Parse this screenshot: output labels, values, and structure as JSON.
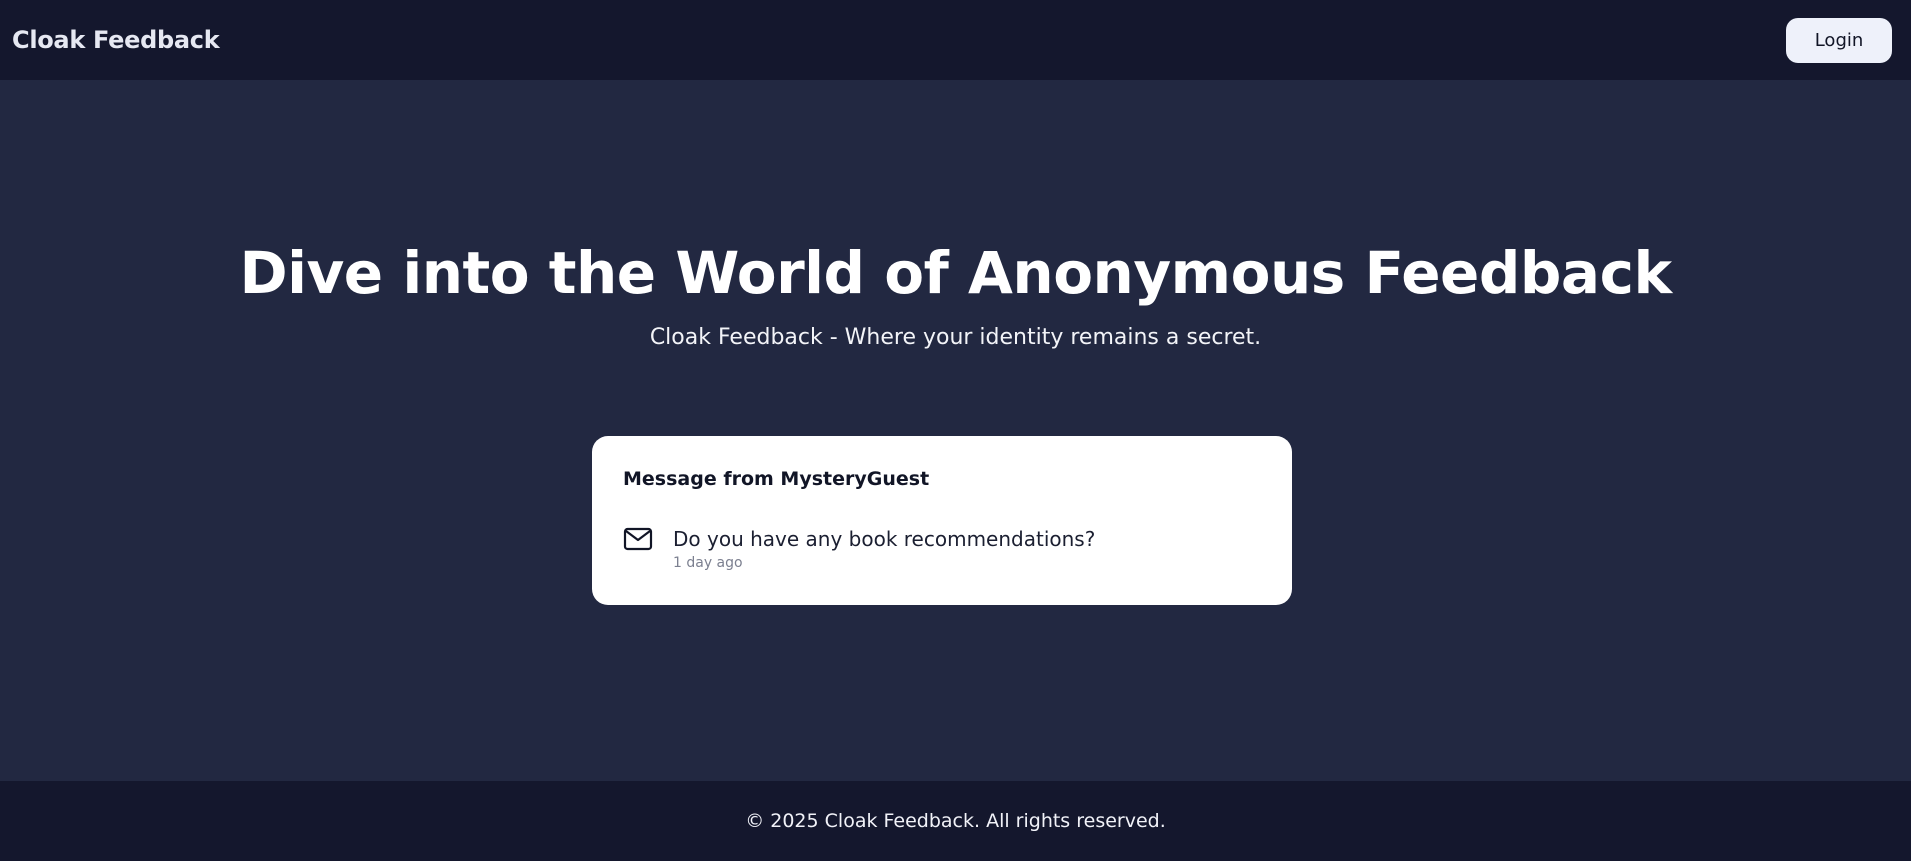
{
  "header": {
    "brand": "Cloak Feedback",
    "login_label": "Login"
  },
  "hero": {
    "title": "Dive into the World of Anonymous Feedback",
    "subtitle": "Cloak Feedback - Where your identity remains a secret."
  },
  "message_card": {
    "title": "Message from MysteryGuest",
    "icon": "mail-icon",
    "message": "Do you have any book recommendations?",
    "time": "1 day ago"
  },
  "footer": {
    "text": "© 2025 Cloak Feedback. All rights reserved."
  },
  "colors": {
    "header_bg": "#14172d",
    "page_bg": "#222841",
    "card_bg": "#ffffff",
    "button_bg": "#eef1fa"
  }
}
